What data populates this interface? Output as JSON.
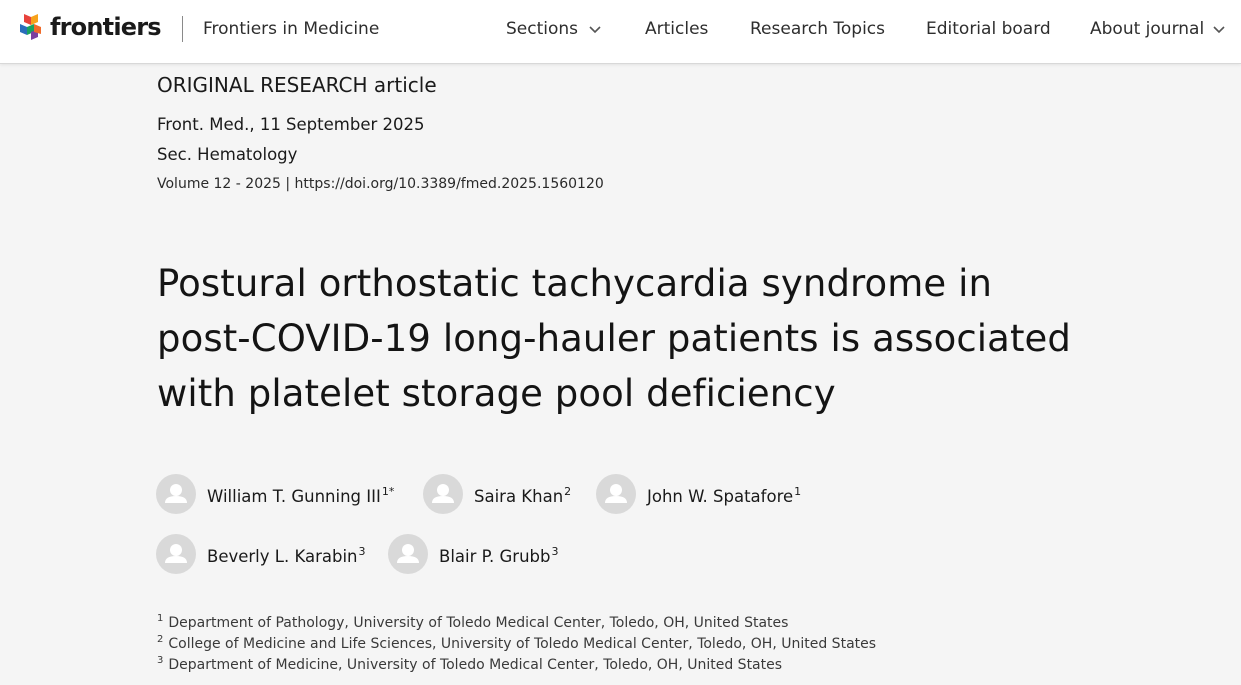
{
  "header": {
    "logo_text": "frontiers",
    "journal_name": "Frontiers in Medicine",
    "nav": [
      {
        "label": "Sections",
        "has_dropdown": true
      },
      {
        "label": "Articles",
        "has_dropdown": false
      },
      {
        "label": "Research Topics",
        "has_dropdown": false
      },
      {
        "label": "Editorial board",
        "has_dropdown": false
      },
      {
        "label": "About journal",
        "has_dropdown": true
      }
    ]
  },
  "article": {
    "type": "ORIGINAL RESEARCH article",
    "journal_date": "Front. Med., 11 September 2025",
    "section": "Sec. Hematology",
    "volume": "Volume 12 - 2025",
    "separator": "|",
    "doi": "https://doi.org/10.3389/fmed.2025.1560120",
    "title": "Postural orthostatic tachycardia syndrome in post-COVID-19 long-hauler patients is associated with platelet storage pool deficiency"
  },
  "authors": [
    {
      "name": "William T. Gunning III",
      "sup": "1*"
    },
    {
      "name": "Saira Khan",
      "sup": "2"
    },
    {
      "name": "John W. Spatafore",
      "sup": "1"
    },
    {
      "name": "Beverly L. Karabin",
      "sup": "3"
    },
    {
      "name": "Blair P. Grubb",
      "sup": "3"
    }
  ],
  "affiliations": [
    {
      "num": "1",
      "text": "Department of Pathology, University of Toledo Medical Center, Toledo, OH, United States"
    },
    {
      "num": "2",
      "text": "College of Medicine and Life Sciences, University of Toledo Medical Center, Toledo, OH, United States"
    },
    {
      "num": "3",
      "text": "Department of Medicine, University of Toledo Medical Center, Toledo, OH, United States"
    }
  ],
  "colors": {
    "background": "#f5f5f5",
    "header_bg": "#ffffff",
    "avatar_bg": "#d9d9d9",
    "logo_colors": [
      "#e8423b",
      "#f7a21b",
      "#2a6ebb",
      "#1aa260",
      "#7b3fa0"
    ]
  },
  "icons": {
    "logo": "frontiers-logo-icon",
    "dropdown": "chevron-down-icon",
    "avatar": "user-avatar-icon"
  }
}
